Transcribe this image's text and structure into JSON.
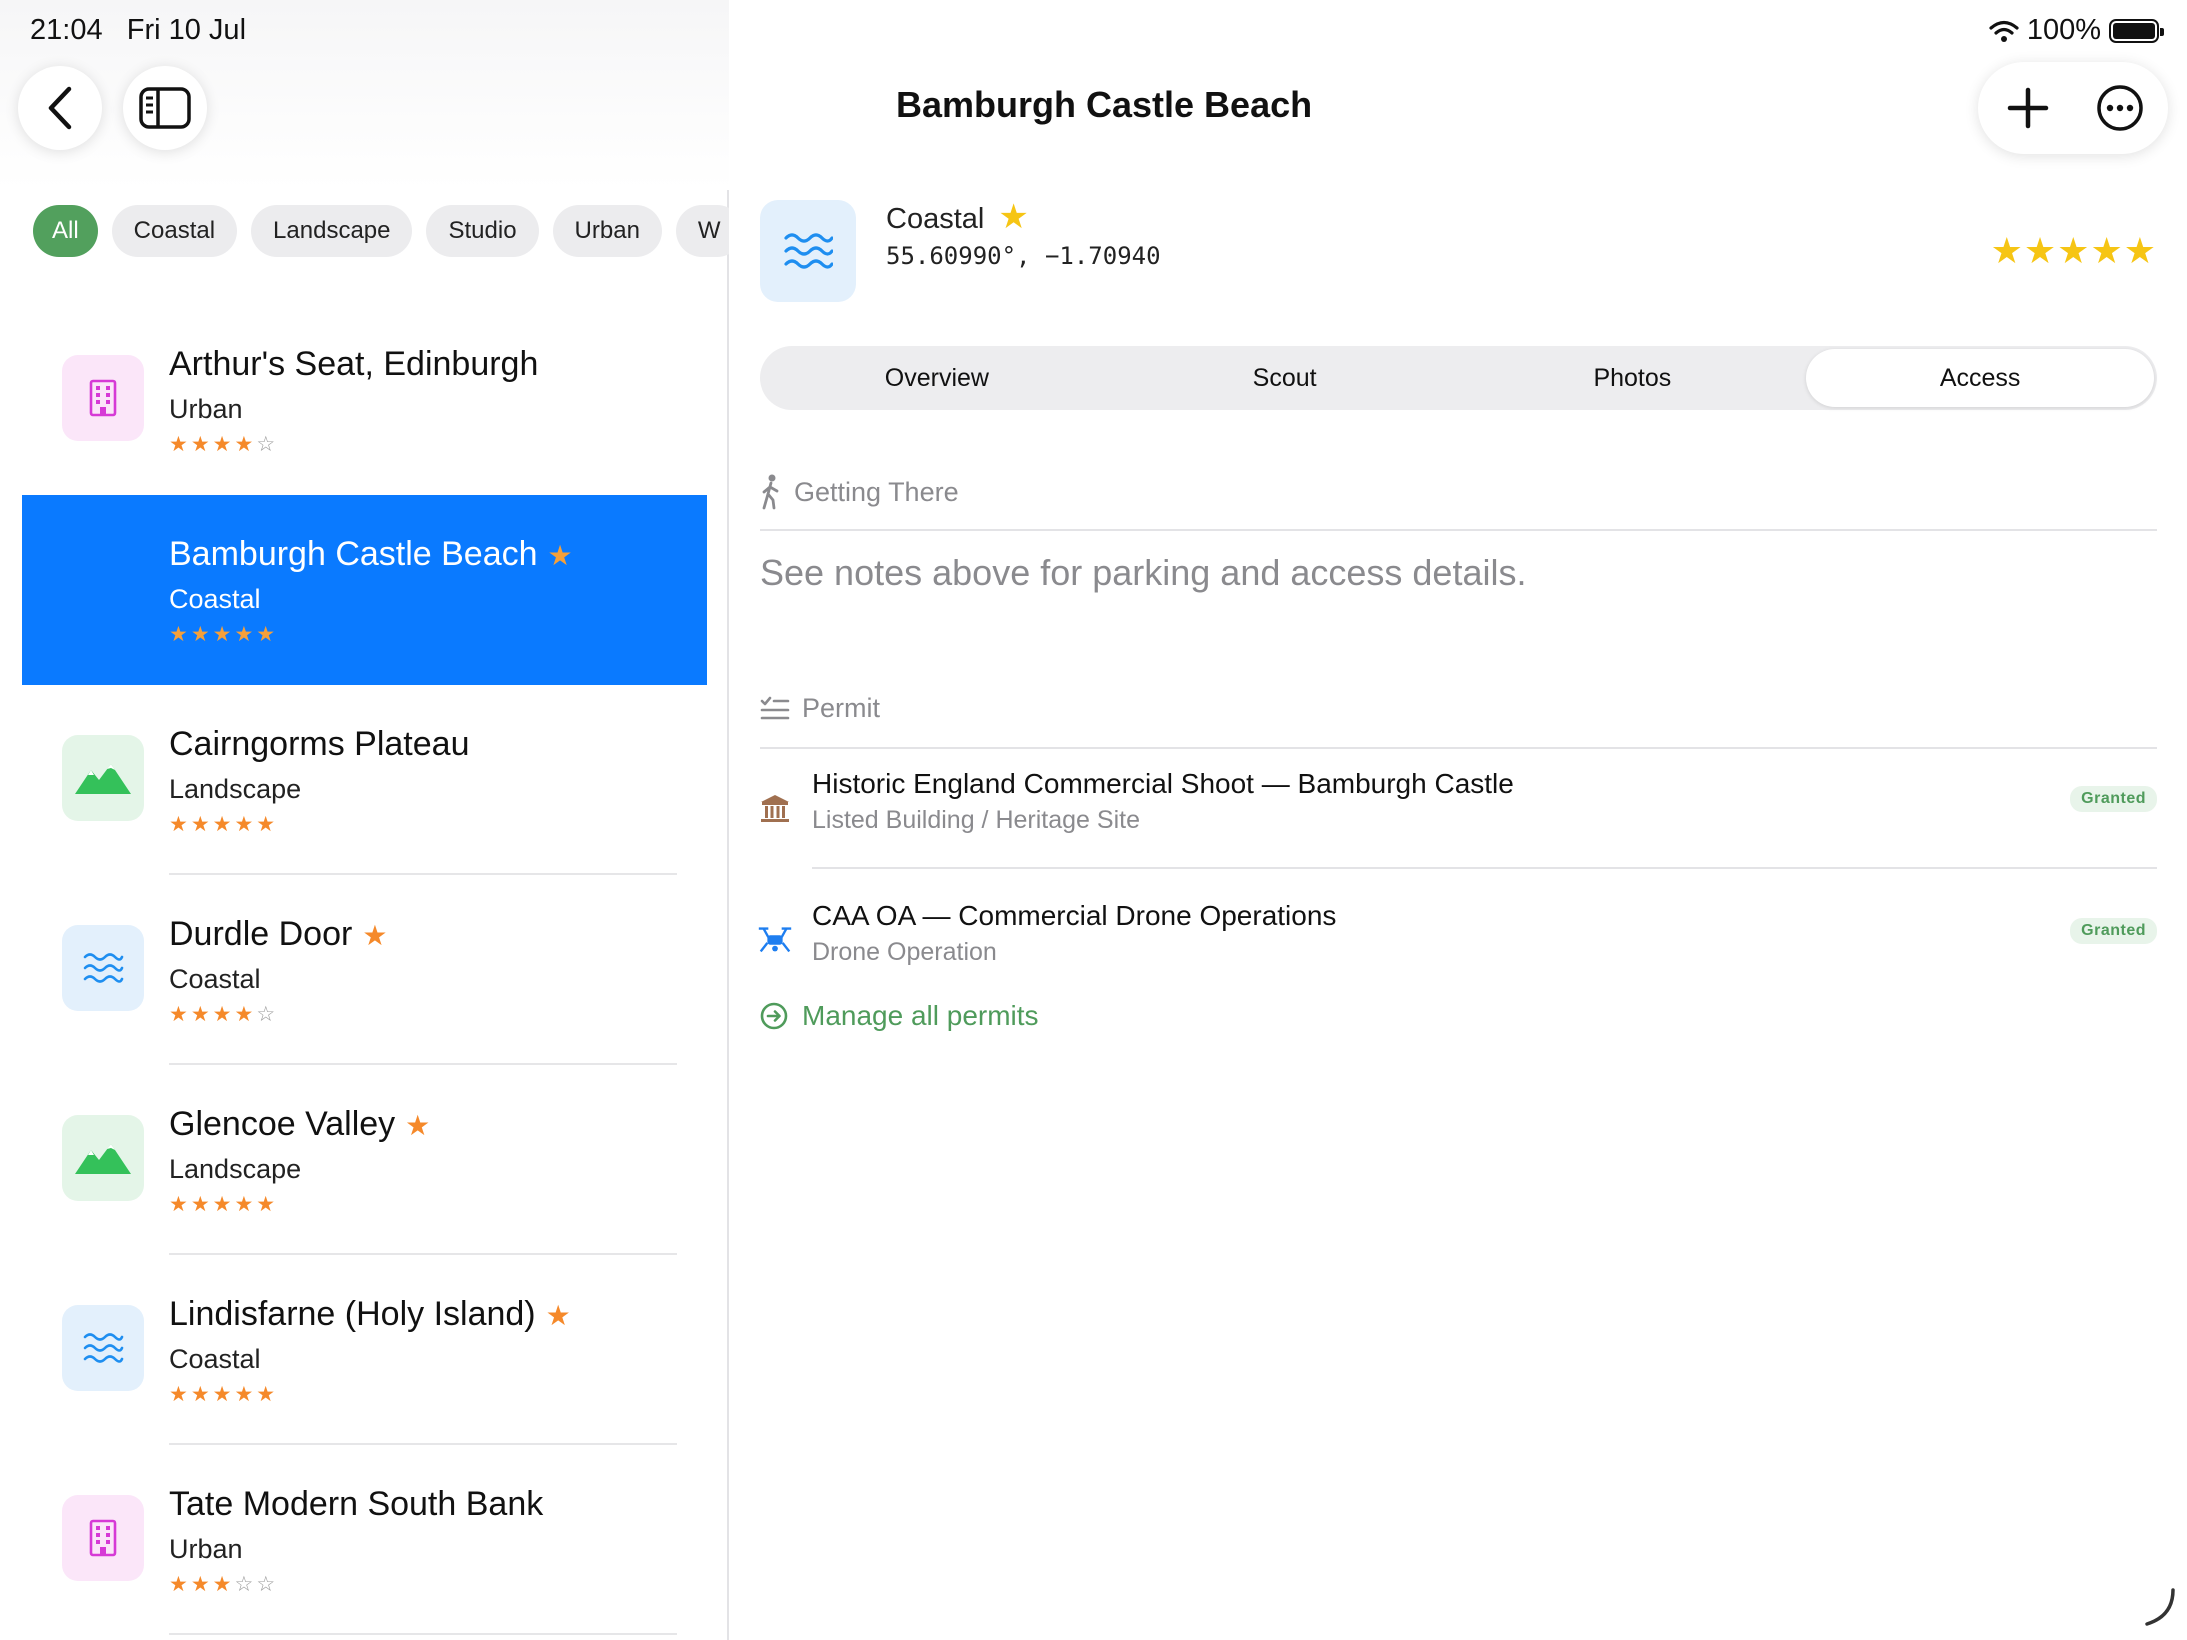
{
  "status_bar": {
    "time": "21:04",
    "date": "Fri 10 Jul",
    "battery": "100%",
    "wifi_icon": "wifi-icon",
    "battery_icon": "battery-icon"
  },
  "toolbar": {
    "back_icon": "chevron-left-icon",
    "sidebar_icon": "sidebar-toggle-icon",
    "title": "Bamburgh Castle Beach",
    "add_icon": "plus-icon",
    "more_icon": "ellipsis-circle-icon"
  },
  "filters": {
    "items": [
      "All",
      "Coastal",
      "Landscape",
      "Studio",
      "Urban",
      "W"
    ],
    "selected": "All"
  },
  "locations": [
    {
      "name": "Arthur's Seat, Edinburgh",
      "category": "Urban",
      "rating": 4,
      "favorite": false,
      "icon": "building-icon"
    },
    {
      "name": "Bamburgh Castle Beach",
      "category": "Coastal",
      "rating": 5,
      "favorite": true,
      "icon": "waves-icon",
      "selected": true
    },
    {
      "name": "Cairngorms Plateau",
      "category": "Landscape",
      "rating": 5,
      "favorite": false,
      "icon": "mountains-icon"
    },
    {
      "name": "Durdle Door",
      "category": "Coastal",
      "rating": 4,
      "favorite": true,
      "icon": "waves-icon"
    },
    {
      "name": "Glencoe Valley",
      "category": "Landscape",
      "rating": 5,
      "favorite": true,
      "icon": "mountains-icon"
    },
    {
      "name": "Lindisfarne (Holy Island)",
      "category": "Coastal",
      "rating": 5,
      "favorite": true,
      "icon": "waves-icon"
    },
    {
      "name": "Tate Modern South Bank",
      "category": "Urban",
      "rating": 3,
      "favorite": false,
      "icon": "building-icon"
    }
  ],
  "detail": {
    "category": "Coastal",
    "favorite": true,
    "coordinates": "55.60990°, −1.70940",
    "rating": 5,
    "tabs": [
      "Overview",
      "Scout",
      "Photos",
      "Access"
    ],
    "active_tab": "Access",
    "getting_there": {
      "heading": "Getting There",
      "note": "See notes above for parking and access details."
    },
    "permit": {
      "heading": "Permit",
      "items": [
        {
          "title": "Historic England Commercial Shoot — Bamburgh Castle",
          "subtitle": "Listed Building / Heritage Site",
          "status": "Granted",
          "icon": "landmark-icon"
        },
        {
          "title": "CAA OA — Commercial Drone Operations",
          "subtitle": "Drone Operation",
          "status": "Granted",
          "icon": "drone-icon"
        }
      ],
      "manage_label": "Manage all permits"
    }
  },
  "colors": {
    "accent_green": "#52a05d",
    "selection_blue": "#0a7aff",
    "star_orange": "#f5892a",
    "star_yellow": "#f6c514"
  }
}
